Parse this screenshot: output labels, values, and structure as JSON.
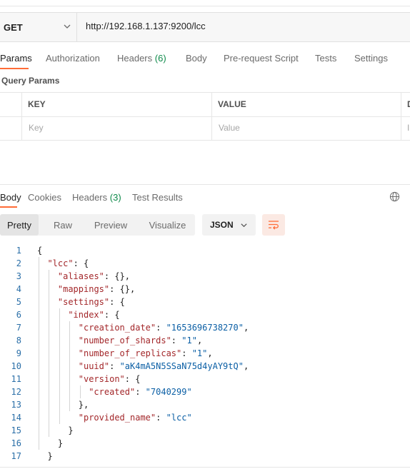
{
  "request": {
    "method": "GET",
    "url": "http://192.168.1.137:9200/lcc"
  },
  "request_tabs": [
    {
      "label": "Params",
      "active": true
    },
    {
      "label": "Authorization"
    },
    {
      "label": "Headers",
      "count": "(6)"
    },
    {
      "label": "Body"
    },
    {
      "label": "Pre-request Script"
    },
    {
      "label": "Tests"
    },
    {
      "label": "Settings"
    }
  ],
  "query_params": {
    "title": "Query Params",
    "headers": {
      "key": "KEY",
      "value": "VALUE",
      "desc": "D"
    },
    "placeholder_row": {
      "key": "Key",
      "value": "Value",
      "desc": "I"
    }
  },
  "response_tabs": [
    {
      "label": "Body",
      "active": true
    },
    {
      "label": "Cookies"
    },
    {
      "label": "Headers",
      "count": "(3)"
    },
    {
      "label": "Test Results"
    }
  ],
  "format_toolbar": {
    "views": [
      "Pretty",
      "Raw",
      "Preview",
      "Visualize"
    ],
    "active_view": "Pretty",
    "format": "JSON"
  },
  "colors": {
    "accent": "#ff6c37",
    "count_green": "#0e8a4a",
    "json_key": "#a3272a",
    "json_string": "#0b5fa5",
    "line_number": "#2b6fa8"
  },
  "icons": [
    "chevron-down-icon",
    "globe-icon",
    "wrap-lines-icon"
  ],
  "code_lines": [
    [
      {
        "t": "{",
        "c": "p"
      }
    ],
    [
      {
        "t": "\"lcc\"",
        "c": "k"
      },
      {
        "t": ": {",
        "c": "p"
      }
    ],
    [
      {
        "t": "\"aliases\"",
        "c": "k"
      },
      {
        "t": ": {},",
        "c": "p"
      }
    ],
    [
      {
        "t": "\"mappings\"",
        "c": "k"
      },
      {
        "t": ": {},",
        "c": "p"
      }
    ],
    [
      {
        "t": "\"settings\"",
        "c": "k"
      },
      {
        "t": ": {",
        "c": "p"
      }
    ],
    [
      {
        "t": "\"index\"",
        "c": "k"
      },
      {
        "t": ": {",
        "c": "p"
      }
    ],
    [
      {
        "t": "\"creation_date\"",
        "c": "k"
      },
      {
        "t": ": ",
        "c": "p"
      },
      {
        "t": "\"1653696738270\"",
        "c": "s"
      },
      {
        "t": ",",
        "c": "p"
      }
    ],
    [
      {
        "t": "\"number_of_shards\"",
        "c": "k"
      },
      {
        "t": ": ",
        "c": "p"
      },
      {
        "t": "\"1\"",
        "c": "s"
      },
      {
        "t": ",",
        "c": "p"
      }
    ],
    [
      {
        "t": "\"number_of_replicas\"",
        "c": "k"
      },
      {
        "t": ": ",
        "c": "p"
      },
      {
        "t": "\"1\"",
        "c": "s"
      },
      {
        "t": ",",
        "c": "p"
      }
    ],
    [
      {
        "t": "\"uuid\"",
        "c": "k"
      },
      {
        "t": ": ",
        "c": "p"
      },
      {
        "t": "\"aK4mA5N5SSaN75d4yAY9tQ\"",
        "c": "s"
      },
      {
        "t": ",",
        "c": "p"
      }
    ],
    [
      {
        "t": "\"version\"",
        "c": "k"
      },
      {
        "t": ": {",
        "c": "p"
      }
    ],
    [
      {
        "t": "\"created\"",
        "c": "k"
      },
      {
        "t": ": ",
        "c": "p"
      },
      {
        "t": "\"7040299\"",
        "c": "s"
      }
    ],
    [
      {
        "t": "},",
        "c": "p"
      }
    ],
    [
      {
        "t": "\"provided_name\"",
        "c": "k"
      },
      {
        "t": ": ",
        "c": "p"
      },
      {
        "t": "\"lcc\"",
        "c": "s"
      }
    ],
    [
      {
        "t": "}",
        "c": "p"
      }
    ],
    [
      {
        "t": "}",
        "c": "p"
      }
    ],
    [
      {
        "t": "}",
        "c": "p"
      }
    ]
  ]
}
